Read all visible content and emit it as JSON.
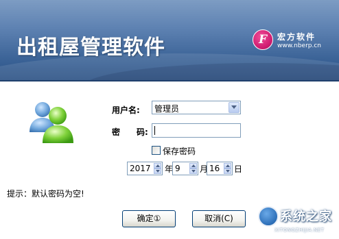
{
  "header": {
    "title": "出租屋管理软件",
    "brand_logo_letter": "F",
    "brand_name": "宏方软件",
    "brand_url": "www.nberp.cn",
    "colors": {
      "banner_top": "#7d9cc3",
      "banner_bottom": "#2b5184",
      "logo": "#d21f73"
    }
  },
  "login": {
    "user_label": "用户名:",
    "user_value": "管理员",
    "pass_label_1": "密",
    "pass_label_2": "码:",
    "pass_value": "",
    "remember_label": "保存密码",
    "remember_checked": false
  },
  "date": {
    "year": "2017",
    "year_unit": "年",
    "month": "9",
    "month_unit": "月",
    "day": "16",
    "day_unit": "日"
  },
  "hint": "提示：默认密码为空!",
  "buttons": {
    "ok": "确定①",
    "cancel": "取消(C)"
  },
  "watermark": {
    "text": "系统之家",
    "sub": "XITONGZHIJIA.NET"
  },
  "icons": [
    "users-icon",
    "brand-logo-icon",
    "dropdown-arrow-icon",
    "spin-up-icon",
    "spin-down-icon"
  ]
}
